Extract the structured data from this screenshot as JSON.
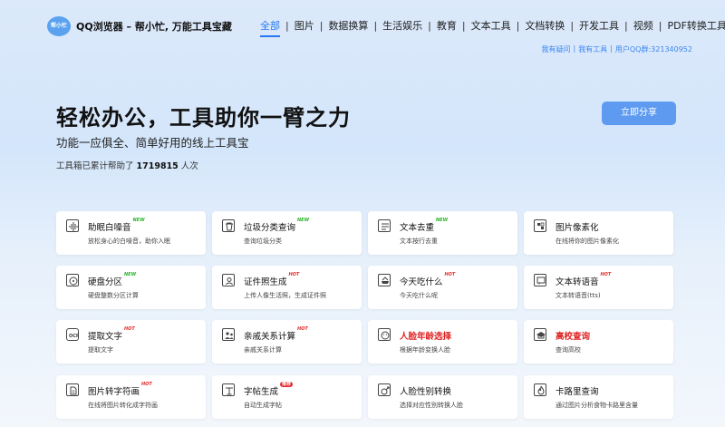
{
  "brand": {
    "logo_text": "帮小忙",
    "title": "QQ浏览器 – 帮小忙, 万能工具宝藏"
  },
  "nav": [
    "全部",
    "图片",
    "数据换算",
    "生活娱乐",
    "教育",
    "文本工具",
    "文档转换",
    "开发工具",
    "视频",
    "PDF转换工具"
  ],
  "sublinks": [
    "我有疑问",
    "我有工具",
    "用户QQ群:321340952"
  ],
  "hero": {
    "title": "轻松办公，工具助你一臂之力",
    "subtitle": "功能一应俱全、简单好用的线上工具宝",
    "count_prefix": "工具箱已累计帮助了",
    "count": "1719815",
    "count_suffix": "人次",
    "share_label": "立即分享"
  },
  "tools": [
    {
      "icon": "sound-wave-icon",
      "title": "助眠白噪音",
      "desc": "放松身心的白噪音，助你入眠",
      "badge": "NEW",
      "badge_type": "new"
    },
    {
      "icon": "trash-icon",
      "title": "垃圾分类查询",
      "desc": "查询垃圾分类",
      "badge": "NEW",
      "badge_type": "new"
    },
    {
      "icon": "text-icon",
      "title": "文本去重",
      "desc": "文本按行去重",
      "badge": "NEW",
      "badge_type": "new"
    },
    {
      "icon": "pixel-icon",
      "title": "图片像素化",
      "desc": "在线将你的图片像素化",
      "badge": "",
      "badge_type": ""
    },
    {
      "icon": "disk-icon",
      "title": "硬盘分区",
      "desc": "硬盘整数分区计算",
      "badge": "NEW",
      "badge_type": "new"
    },
    {
      "icon": "id-photo-icon",
      "title": "证件照生成",
      "desc": "上传人像生活照，生成证件照",
      "badge": "HOT",
      "badge_type": "hot"
    },
    {
      "icon": "food-icon",
      "title": "今天吃什么",
      "desc": "今天吃什么呢",
      "badge": "HOT",
      "badge_type": "hot"
    },
    {
      "icon": "speech-icon",
      "title": "文本转语音",
      "desc": "文本转语音(tts)",
      "badge": "HOT",
      "badge_type": "hot"
    },
    {
      "icon": "ocr-icon",
      "title": "提取文字",
      "desc": "提取文字",
      "badge": "HOT",
      "badge_type": "hot"
    },
    {
      "icon": "family-icon",
      "title": "亲戚关系计算",
      "desc": "亲戚关系计算",
      "badge": "HOT",
      "badge_type": "hot"
    },
    {
      "icon": "face-age-icon",
      "title": "人脸年龄选择",
      "desc": "根据年龄变换人脸",
      "badge": "",
      "badge_type": "",
      "red": true
    },
    {
      "icon": "school-icon",
      "title": "高校查询",
      "desc": "查询高校",
      "badge": "",
      "badge_type": "",
      "red": true
    },
    {
      "icon": "ascii-art-icon",
      "title": "图片转字符画",
      "desc": "在线将图片转化成字符画",
      "badge": "HOT",
      "badge_type": "hot"
    },
    {
      "icon": "sticker-icon",
      "title": "字帖生成",
      "desc": "自动生成字帖",
      "badge": "推荐",
      "badge_type": "hot2"
    },
    {
      "icon": "face-gender-icon",
      "title": "人脸性别转换",
      "desc": "选择对应性别转换人脸",
      "badge": "",
      "badge_type": ""
    },
    {
      "icon": "calorie-icon",
      "title": "卡路里查询",
      "desc": "通过图片分析食物卡路里含量",
      "badge": "",
      "badge_type": ""
    }
  ]
}
